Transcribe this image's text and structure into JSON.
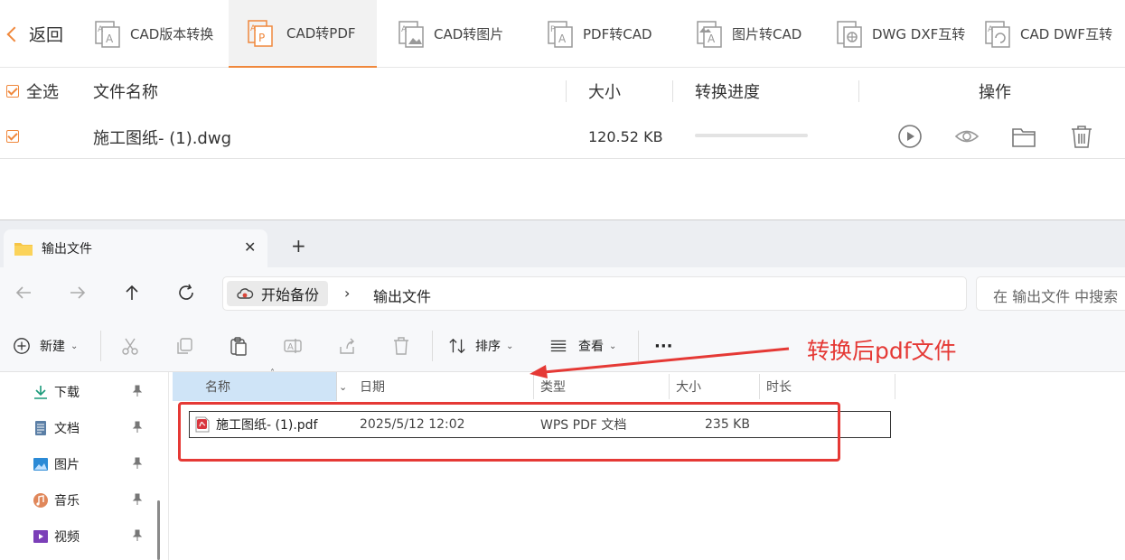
{
  "app": {
    "back_label": "返回",
    "tabs": [
      {
        "label": "CAD版本转换",
        "active": false
      },
      {
        "label": "CAD转PDF",
        "active": true
      },
      {
        "label": "CAD转图片",
        "active": false
      },
      {
        "label": "PDF转CAD",
        "active": false
      },
      {
        "label": "图片转CAD",
        "active": false
      },
      {
        "label": "DWG DXF互转",
        "active": false
      },
      {
        "label": "CAD DWF互转",
        "active": false
      }
    ],
    "accent_color": "#f0883c",
    "list": {
      "select_all": "全选",
      "col_name": "文件名称",
      "col_size": "大小",
      "col_progress": "转换进度",
      "col_actions": "操作",
      "rows": [
        {
          "name": "施工图纸- (1).dwg",
          "size": "120.52 KB",
          "progress": 0,
          "actions": [
            "play-icon",
            "eye-icon",
            "folder-icon",
            "trash-icon"
          ]
        }
      ]
    }
  },
  "explorer": {
    "tab_title": "输出文件",
    "breadcrumb": [
      "开始备份",
      "输出文件"
    ],
    "search_placeholder": "在 输出文件 中搜索",
    "toolbar": {
      "new_label": "新建",
      "sort_label": "排序",
      "view_label": "查看",
      "more_label": "···"
    },
    "sidebar": [
      {
        "label": "下载",
        "icon": "download-icon"
      },
      {
        "label": "文档",
        "icon": "document-icon"
      },
      {
        "label": "图片",
        "icon": "picture-icon"
      },
      {
        "label": "音乐",
        "icon": "music-icon"
      },
      {
        "label": "视频",
        "icon": "video-icon"
      }
    ],
    "columns": [
      "名称",
      "日期",
      "类型",
      "大小",
      "时长"
    ],
    "files": [
      {
        "name": "施工图纸- (1).pdf",
        "date": "2025/5/12 12:02",
        "type": "WPS PDF 文档",
        "size": "235 KB",
        "duration": ""
      }
    ]
  },
  "annotation": {
    "text": "转换后pdf文件",
    "color": "#e53935"
  }
}
